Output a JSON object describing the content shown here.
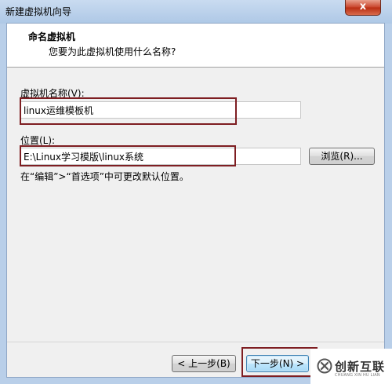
{
  "window": {
    "title": "新建虚拟机向导",
    "close_label": "x"
  },
  "header": {
    "title": "命名虚拟机",
    "subtitle": "您要为此虚拟机使用什么名称?"
  },
  "name_field": {
    "label": "虚拟机名称(V):",
    "value": "linux运维模板机"
  },
  "location_field": {
    "label": "位置(L):",
    "value": "E:\\Linux学习模版\\linux系统",
    "browse_label": "浏览(R)..."
  },
  "hint": "在“编辑”>“首选项”中可更改默认位置。",
  "footer": {
    "back_label": "< 上一步(B)",
    "next_label": "下一步(N) >"
  },
  "watermark": {
    "brand": "创新互联",
    "sub": "CHUANG XIN HU LIAN"
  },
  "colors": {
    "highlight": "#7e1e22",
    "title_gradient_top": "#c9dbf0",
    "close_red": "#c9432a"
  }
}
